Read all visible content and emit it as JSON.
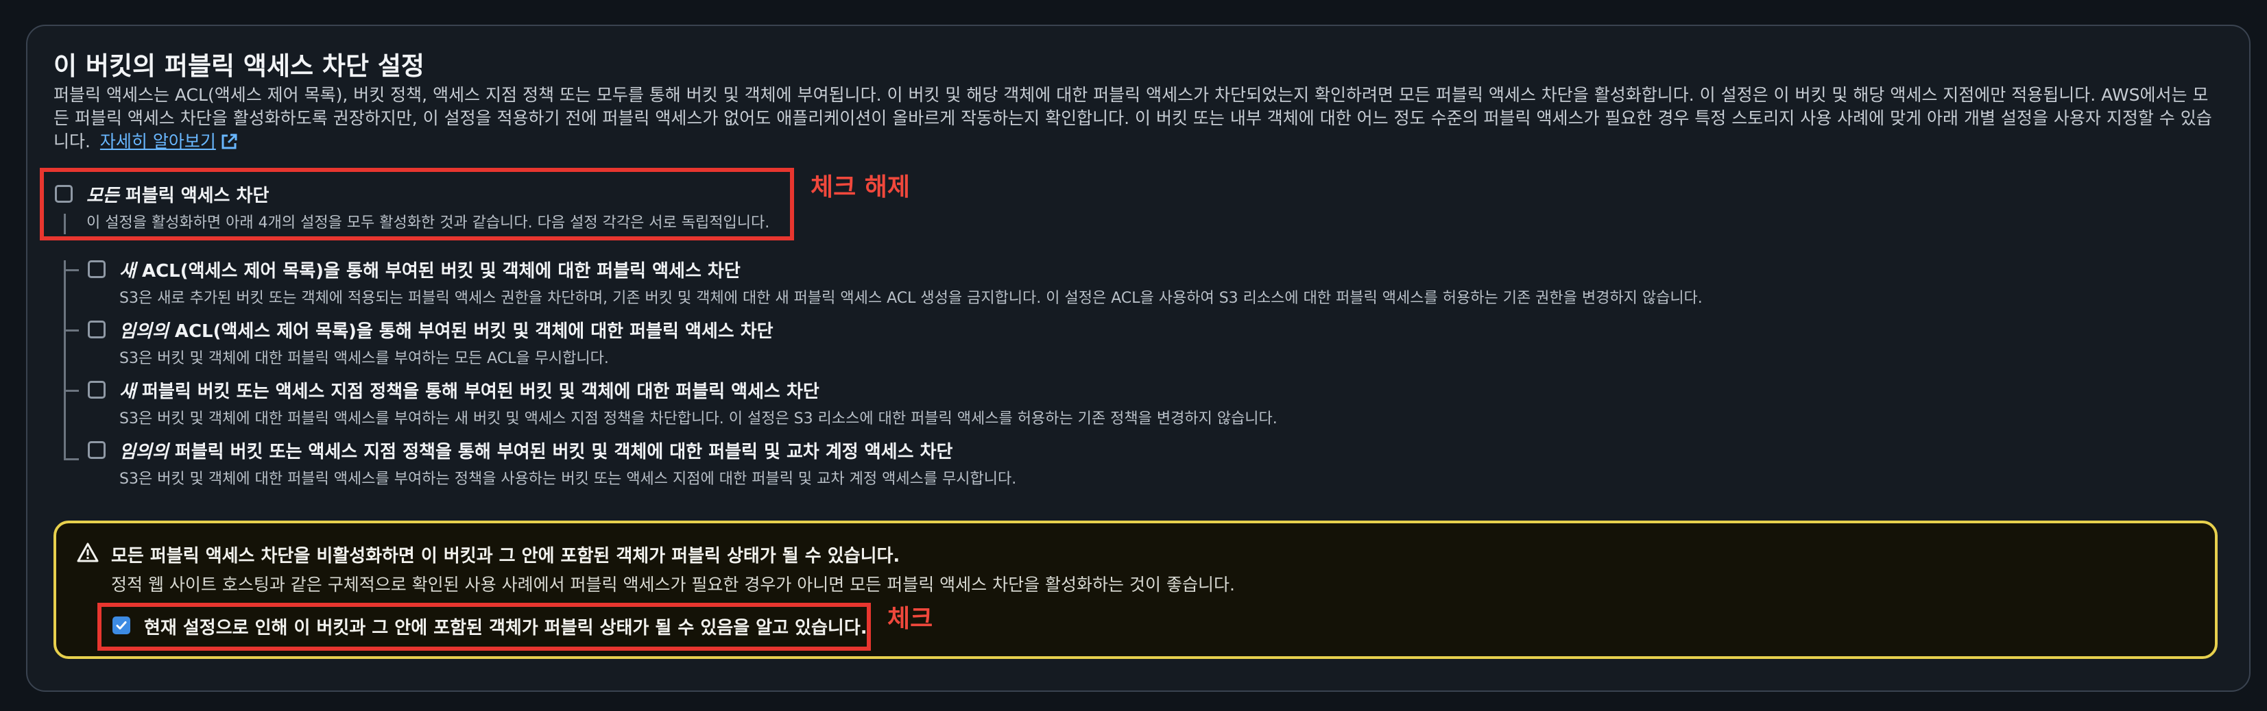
{
  "section": {
    "title": "이 버킷의 퍼블릭 액세스 차단 설정",
    "description": "퍼블릭 액세스는 ACL(액세스 제어 목록), 버킷 정책, 액세스 지점 정책 또는 모두를 통해 버킷 및 객체에 부여됩니다. 이 버킷 및 해당 객체에 대한 퍼블릭 액세스가 차단되었는지 확인하려면 모든 퍼블릭 액세스 차단을 활성화합니다. 이 설정은 이 버킷 및 해당 액세스 지점에만 적용됩니다. AWS에서는 모든 퍼블릭 액세스 차단을 활성화하도록 권장하지만, 이 설정을 적용하기 전에 퍼블릭 액세스가 없어도 애플리케이션이 올바르게 작동하는지 확인합니다. 이 버킷 또는 내부 객체에 대한 어느 정도 수준의 퍼블릭 액세스가 필요한 경우 특정 스토리지 사용 사례에 맞게 아래 개별 설정을 사용자 지정할 수 있습니다.",
    "learn_more": "자세히 알아보기"
  },
  "block_all": {
    "title_em": "모든",
    "title_rest": " 퍼블릭 액세스 차단",
    "subtitle": "이 설정을 활성화하면 아래 4개의 설정을 모두 활성화한 것과 같습니다. 다음 설정 각각은 서로 독립적입니다.",
    "checked": false
  },
  "options": [
    {
      "title_em": "새",
      "title_rest": " ACL(액세스 제어 목록)을 통해 부여된 버킷 및 객체에 대한 퍼블릭 액세스 차단",
      "subtitle": "S3은 새로 추가된 버킷 또는 객체에 적용되는 퍼블릭 액세스 권한을 차단하며, 기존 버킷 및 객체에 대한 새 퍼블릭 액세스 ACL 생성을 금지합니다. 이 설정은 ACL을 사용하여 S3 리소스에 대한 퍼블릭 액세스를 허용하는 기존 권한을 변경하지 않습니다."
    },
    {
      "title_em": "임의의",
      "title_rest": " ACL(액세스 제어 목록)을 통해 부여된 버킷 및 객체에 대한 퍼블릭 액세스 차단",
      "subtitle": "S3은 버킷 및 객체에 대한 퍼블릭 액세스를 부여하는 모든 ACL을 무시합니다."
    },
    {
      "title_em": "새",
      "title_rest": " 퍼블릭 버킷 또는 액세스 지점 정책을 통해 부여된 버킷 및 객체에 대한 퍼블릭 액세스 차단",
      "subtitle": "S3은 버킷 및 객체에 대한 퍼블릭 액세스를 부여하는 새 버킷 및 액세스 지점 정책을 차단합니다. 이 설정은 S3 리소스에 대한 퍼블릭 액세스를 허용하는 기존 정책을 변경하지 않습니다."
    },
    {
      "title_em": "임의의",
      "title_rest": " 퍼블릭 버킷 또는 액세스 지점 정책을 통해 부여된 버킷 및 객체에 대한 퍼블릭 및 교차 계정 액세스 차단",
      "subtitle": "S3은 버킷 및 객체에 대한 퍼블릭 액세스를 부여하는 정책을 사용하는 버킷 또는 액세스 지점에 대한 퍼블릭 및 교차 계정 액세스를 무시합니다."
    }
  ],
  "warning": {
    "title": "모든 퍼블릭 액세스 차단을 비활성화하면 이 버킷과 그 안에 포함된 객체가 퍼블릭 상태가 될 수 있습니다.",
    "text": "정적 웹 사이트 호스팅과 같은 구체적으로 확인된 사용 사례에서 퍼블릭 액세스가 필요한 경우가 아니면 모든 퍼블릭 액세스 차단을 활성화하는 것이 좋습니다.",
    "ack_label": "현재 설정으로 인해 이 버킷과 그 안에 포함된 객체가 퍼블릭 상태가 될 수 있음을 알고 있습니다.",
    "ack_checked": true
  },
  "annotations": {
    "uncheck": "체크 해제",
    "check": "체크"
  },
  "colors": {
    "background": "#0f141a",
    "panel": "#151b22",
    "link": "#69b7ff",
    "annotation": "#e8362f",
    "warning_border": "#e7d04d",
    "checkbox_checked": "#3d8be3"
  }
}
